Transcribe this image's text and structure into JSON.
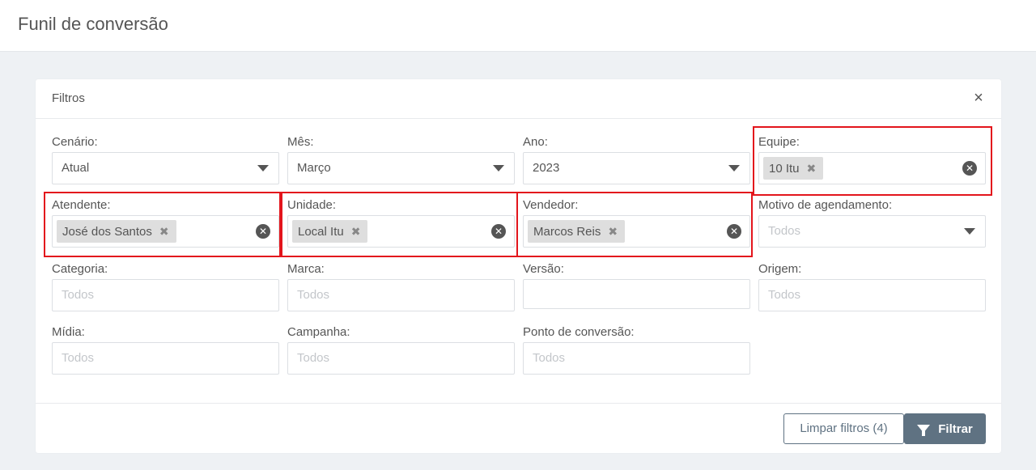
{
  "page": {
    "title": "Funil de conversão"
  },
  "card": {
    "title": "Filtros",
    "close_label": "×"
  },
  "fields": {
    "cenario": {
      "label": "Cenário:",
      "value": "Atual"
    },
    "mes": {
      "label": "Mês:",
      "value": "Março"
    },
    "ano": {
      "label": "Ano:",
      "value": "2023"
    },
    "equipe": {
      "label": "Equipe:",
      "tag": "10 Itu"
    },
    "atendente": {
      "label": "Atendente:",
      "tag": "José dos Santos"
    },
    "unidade": {
      "label": "Unidade:",
      "tag": "Local Itu"
    },
    "vendedor": {
      "label": "Vendedor:",
      "tag": "Marcos Reis"
    },
    "motivo": {
      "label": "Motivo de agendamento:",
      "placeholder": "Todos"
    },
    "categoria": {
      "label": "Categoria:",
      "placeholder": "Todos"
    },
    "marca": {
      "label": "Marca:",
      "placeholder": "Todos"
    },
    "versao": {
      "label": "Versão:",
      "placeholder": ""
    },
    "origem": {
      "label": "Origem:",
      "placeholder": "Todos"
    },
    "midia": {
      "label": "Mídia:",
      "placeholder": "Todos"
    },
    "campanha": {
      "label": "Campanha:",
      "placeholder": "Todos"
    },
    "ponto": {
      "label": "Ponto de conversão:",
      "placeholder": "Todos"
    }
  },
  "icons": {
    "tag_remove": "✖",
    "clear": "✕"
  },
  "footer": {
    "clear_label": "Limpar filtros (4)",
    "filter_label": "Filtrar"
  },
  "colors": {
    "highlight": "#e3151c",
    "primary": "#5f7282"
  }
}
